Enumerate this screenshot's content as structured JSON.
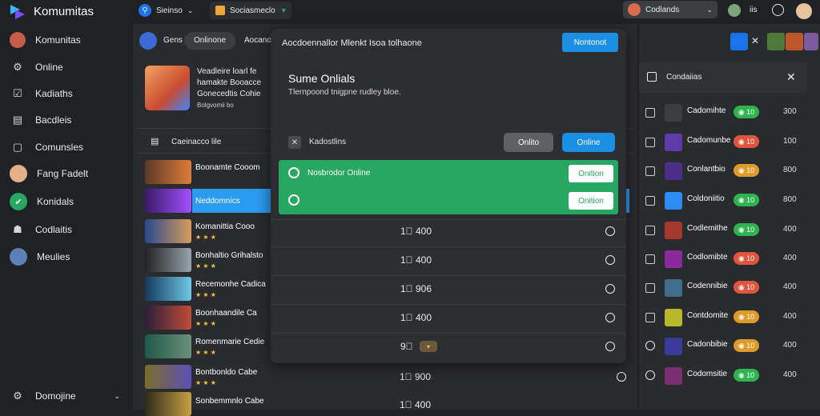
{
  "app": {
    "title": "Komumitas"
  },
  "topbar": {
    "search_label": "Sieinso",
    "tab_label": "Sociasmeclo",
    "account_label": "Codlands",
    "icon_label": "iis"
  },
  "sidebar": {
    "items": [
      {
        "label": "Komunitas",
        "icon": "app-logo-icon"
      },
      {
        "label": "Online",
        "icon": "gear-icon"
      },
      {
        "label": "Kadiaths",
        "icon": "checkbox-icon"
      },
      {
        "label": "Bacdleis",
        "icon": "chat-icon"
      },
      {
        "label": "Comunsles",
        "icon": "chat-bubble-icon"
      },
      {
        "label": "Fang Fadelt",
        "icon": "avatar"
      },
      {
        "label": "Konidals",
        "icon": "check-badge-icon"
      },
      {
        "label": "Codlaitis",
        "icon": "person-icon"
      },
      {
        "label": "Meulies",
        "icon": "avatar"
      }
    ],
    "footer_label": "Domojine"
  },
  "main": {
    "tabs": [
      "Gens",
      "Onlinone",
      "Aocano"
    ],
    "game_card": {
      "title_1": "Veadleire loarl fe",
      "title_2": "hamakte Booacce",
      "title_3": "Gonecedtis Cohie",
      "meta": "Bolgvomii bo"
    },
    "section_label": "Caeinacco lile",
    "rows": [
      {
        "title": "Boonamte Cooom",
        "meta": "",
        "value": ""
      },
      {
        "title": "Neddomnics",
        "meta": "",
        "value": ""
      },
      {
        "title": "Komanittia Cooo",
        "meta": "",
        "value": "1⃣ 400"
      },
      {
        "title": "Bonhaltio Grihalsto",
        "meta": "",
        "value": "1⃣ 400"
      },
      {
        "title": "Recemonhe Cadica",
        "meta": "",
        "value": "1⃣ 906"
      },
      {
        "title": "Boonhaandile Ca",
        "meta": "",
        "value": "1⃣ 400"
      },
      {
        "title": "Romenmarie Cedie",
        "meta": "",
        "value": "9⃣"
      },
      {
        "title": "Bontbonldo Cabe",
        "meta": "",
        "value": "1⃣ 900"
      },
      {
        "title": "Sonbemmnlo Cabe",
        "meta": "",
        "value": "1⃣ 400"
      }
    ]
  },
  "modal": {
    "header_text": "Aocdoennallor Mlenkt Isoa tolhaone",
    "primary_label": "Nontonot",
    "title": "Sume Onlials",
    "description": "Tlernpoond tnigpne rudley bloe.",
    "filter_label": "Kadostlins",
    "filter_offline": "Onlito",
    "filter_online": "Online",
    "green_rows": [
      {
        "text": "Nosbrodor Online",
        "button": "Onition"
      },
      {
        "text": "",
        "button": "Onition"
      }
    ]
  },
  "right_panel": {
    "title": "Condaiias",
    "rows": [
      {
        "label": "Cadomihte",
        "badge": "◉ 10",
        "badge_color": "#2fb34f",
        "value": "300"
      },
      {
        "label": "Cadomunbe",
        "badge": "◉ 10",
        "badge_color": "#e0563c",
        "value": "100"
      },
      {
        "label": "Conlantbio",
        "badge": "◉ 10",
        "badge_color": "#e09a2a",
        "value": "800"
      },
      {
        "label": "Coldoniitio",
        "badge": "◉ 10",
        "badge_color": "#2fb34f",
        "value": "800"
      },
      {
        "label": "Codlemithe",
        "badge": "◉ 10",
        "badge_color": "#2fb34f",
        "value": "400"
      },
      {
        "label": "Codlomibte",
        "badge": "◉ 10",
        "badge_color": "#e0563c",
        "value": "400"
      },
      {
        "label": "Codennibie",
        "badge": "◉ 10",
        "badge_color": "#e0563c",
        "value": "400"
      },
      {
        "label": "Contdomite",
        "badge": "◉ 10",
        "badge_color": "#e09a2a",
        "value": "400"
      },
      {
        "label": "Cadonbibie",
        "badge": "◉ 10",
        "badge_color": "#e09a2a",
        "value": "400"
      },
      {
        "label": "Codomsitie",
        "badge": "◉ 10",
        "badge_color": "#2fb34f",
        "value": "400"
      }
    ]
  },
  "colors": {
    "accent": "#1a8fe3",
    "success": "#27a761",
    "panel": "#2d2e31"
  }
}
